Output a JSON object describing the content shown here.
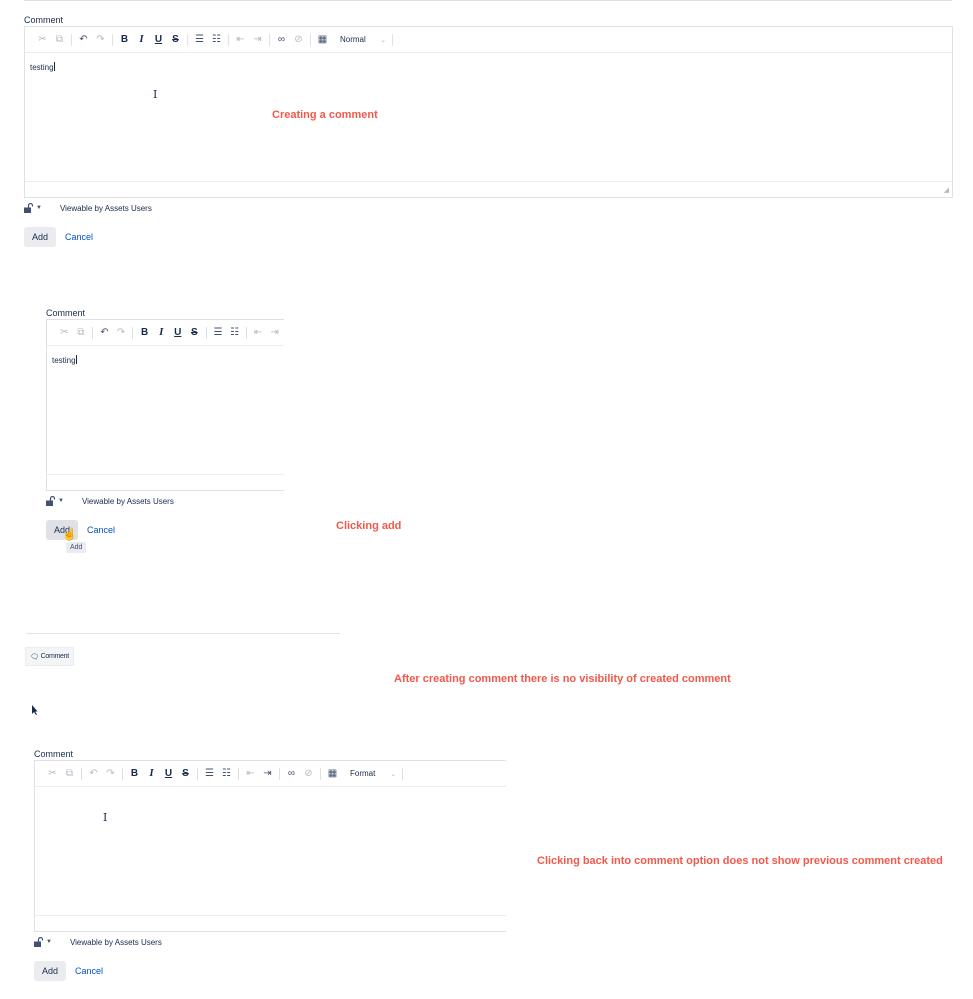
{
  "comment_label": "Comment",
  "format_normal": "Normal",
  "format_label": "Format",
  "editor_text": "testing",
  "visibility": "Viewable by Assets Users",
  "add_label": "Add",
  "cancel_label": "Cancel",
  "tooltip_add": "Add",
  "comment_button": "Comment",
  "annotations": {
    "creating": "Creating a comment",
    "clicking_add": "Clicking add",
    "after_creating": "After creating comment there is no visibility of created comment",
    "clicking_back": "Clicking back into comment option does not show previous comment created"
  },
  "colors": {
    "annotation": "#f2594b",
    "link": "#0052cc",
    "text": "#172b4d"
  },
  "icons": [
    "cut-icon",
    "copy-icon",
    "undo-icon",
    "redo-icon",
    "bold-icon",
    "italic-icon",
    "underline-icon",
    "strikethrough-icon",
    "numbered-list-icon",
    "bullet-list-icon",
    "outdent-icon",
    "indent-icon",
    "link-icon",
    "unlink-icon",
    "table-icon",
    "unlock-icon",
    "hand-pointer-icon",
    "arrow-cursor-icon",
    "text-cursor-icon"
  ]
}
